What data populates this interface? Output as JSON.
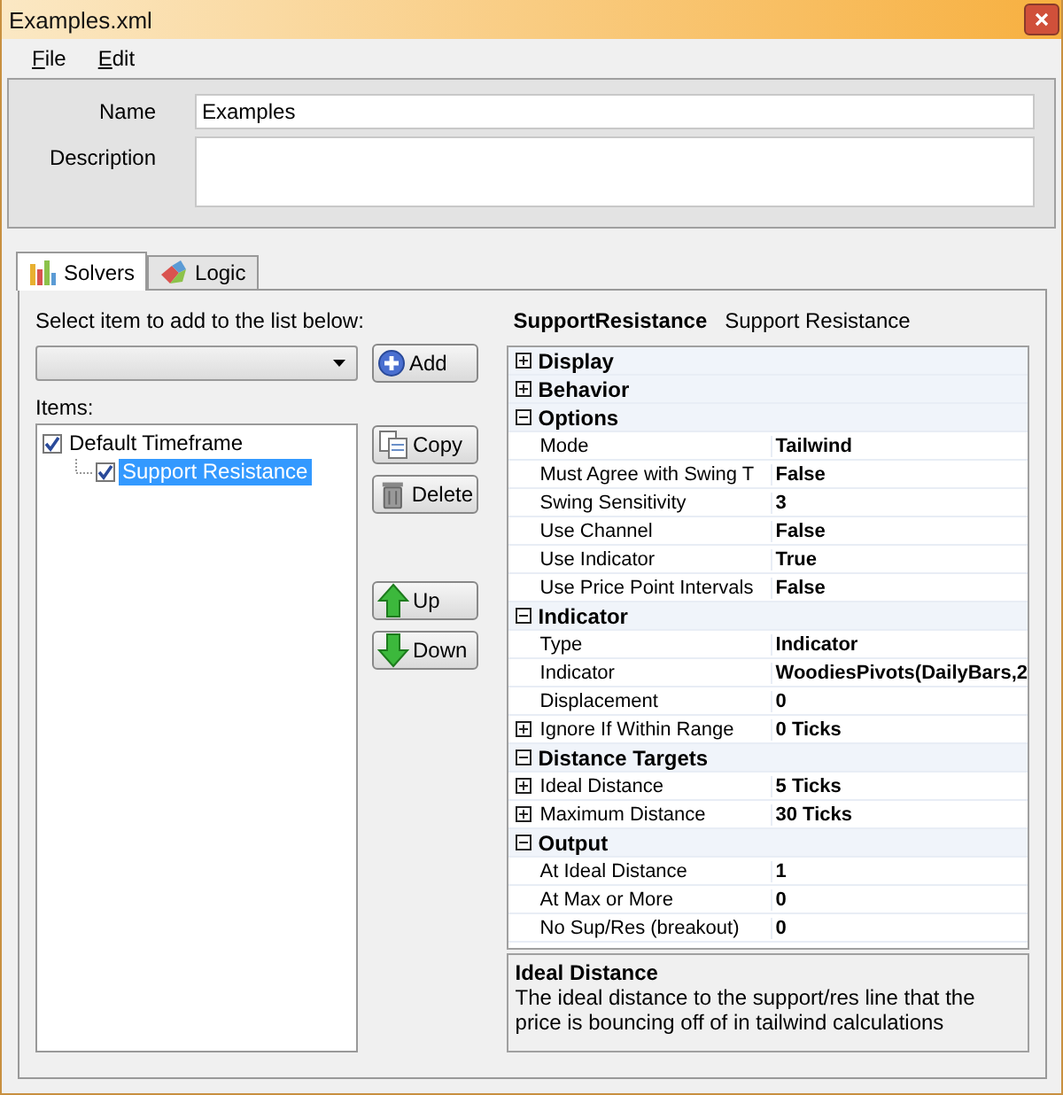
{
  "window": {
    "title": "Examples.xml"
  },
  "menu": [
    {
      "label": "File"
    },
    {
      "label": "Edit"
    }
  ],
  "header": {
    "name_label": "Name",
    "name_value": "Examples",
    "description_label": "Description"
  },
  "tabs": [
    {
      "label": "Solvers",
      "selected": true,
      "kind": "bars"
    },
    {
      "label": "Logic",
      "selected": false,
      "kind": "shapes"
    }
  ],
  "solvers": {
    "select_label": "Select item to add to the list below:",
    "add_button": "Add",
    "items_label": "Items:",
    "tree": [
      {
        "label": "Default Timeframe",
        "checked": true,
        "selected": false,
        "children": [
          {
            "label": "Support Resistance",
            "checked": true,
            "selected": true
          }
        ]
      }
    ],
    "buttons": [
      {
        "label": "Copy",
        "kind": "copy"
      },
      {
        "label": "Delete",
        "kind": "delete"
      },
      {
        "label": "Up",
        "kind": "up"
      },
      {
        "label": "Down",
        "kind": "down"
      }
    ]
  },
  "properties": {
    "object_name": "SupportResistance",
    "object_label": "Support Resistance",
    "categories": [
      {
        "name": "Display",
        "expanded": false
      },
      {
        "name": "Behavior",
        "expanded": false
      },
      {
        "name": "Options",
        "expanded": true,
        "rows": [
          {
            "name": "Mode",
            "value": "Tailwind",
            "kind": "leaf"
          },
          {
            "name": "Must Agree with Swing T",
            "value": "False",
            "kind": "leaf"
          },
          {
            "name": "Swing Sensitivity",
            "value": "3",
            "kind": "leaf"
          },
          {
            "name": "Use Channel",
            "value": "False",
            "kind": "leaf"
          },
          {
            "name": "Use Indicator",
            "value": "True",
            "kind": "leaf"
          },
          {
            "name": "Use Price Point Intervals",
            "value": "False",
            "kind": "leaf"
          }
        ]
      },
      {
        "name": "Indicator",
        "expanded": true,
        "rows": [
          {
            "name": "Type",
            "value": "Indicator",
            "kind": "leaf"
          },
          {
            "name": "Indicator",
            "value": "WoodiesPivots(DailyBars,2",
            "kind": "leaf"
          },
          {
            "name": "Displacement",
            "value": "0",
            "kind": "leaf"
          },
          {
            "name": "Ignore If Within Range",
            "value": "0 Ticks",
            "kind": "collapsed"
          }
        ]
      },
      {
        "name": "Distance Targets",
        "expanded": true,
        "rows": [
          {
            "name": "Ideal Distance",
            "value": "5 Ticks",
            "kind": "collapsed"
          },
          {
            "name": "Maximum Distance",
            "value": "30 Ticks",
            "kind": "collapsed"
          }
        ]
      },
      {
        "name": "Output",
        "expanded": true,
        "rows": [
          {
            "name": "At Ideal Distance",
            "value": "1",
            "kind": "leaf"
          },
          {
            "name": "At Max or More",
            "value": "0",
            "kind": "leaf"
          },
          {
            "name": "No Sup/Res (breakout)",
            "value": "0",
            "kind": "leaf"
          }
        ]
      }
    ],
    "help": {
      "title": "Ideal Distance",
      "text": "The ideal distance to the support/res line that the price is bouncing off of in tailwind calculations"
    }
  }
}
